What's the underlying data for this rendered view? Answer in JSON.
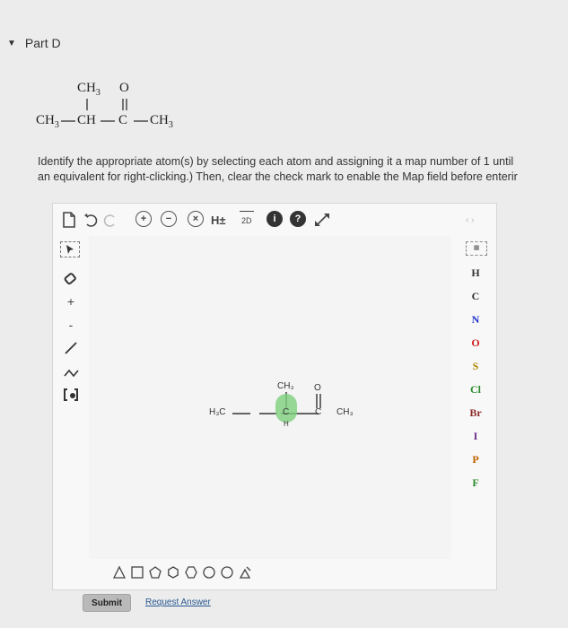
{
  "part": {
    "title": "Part D"
  },
  "formula": {
    "ch3_top": "CH",
    "o_top": "O",
    "ch3_left": "CH",
    "ch": "CH",
    "c": "C",
    "ch3_right": "CH",
    "sub3": "3"
  },
  "instructions": {
    "line1": "Identify the appropriate atom(s) by selecting each atom and assigning it a map number of 1 until",
    "line2": "an equivalent for right-clicking.) Then, clear the check mark to enable the Map field before enterir"
  },
  "toolbar": {
    "hydrogen_label": "H±",
    "twod_label": "2D",
    "info_label": "i",
    "help_label": "?"
  },
  "left_tools": {
    "plus": "+",
    "minus": "-"
  },
  "elements": [
    "H",
    "C",
    "N",
    "O",
    "S",
    "Cl",
    "Br",
    "I",
    "P",
    "F"
  ],
  "molecule": {
    "left_group": "H₃C",
    "center_c": "C",
    "center_h": "H",
    "top_group": "CH₃",
    "carbonyl_o": "O",
    "carbonyl_c": "C",
    "right_group": "CH₃"
  },
  "colors": {
    "accent_green": "#4caf50",
    "highlight_green": "#7ed07e",
    "element_N": "#2233cc",
    "element_O": "#d02020",
    "element_S": "#b08a00",
    "element_Cl": "#2a8a2a",
    "element_Br": "#8a2a2a",
    "element_I": "#6a2a8a",
    "element_P": "#c06000",
    "element_F": "#2a8a2a"
  },
  "actions": {
    "submit_label": "Submit",
    "request_answer_label": "Request Answer"
  }
}
